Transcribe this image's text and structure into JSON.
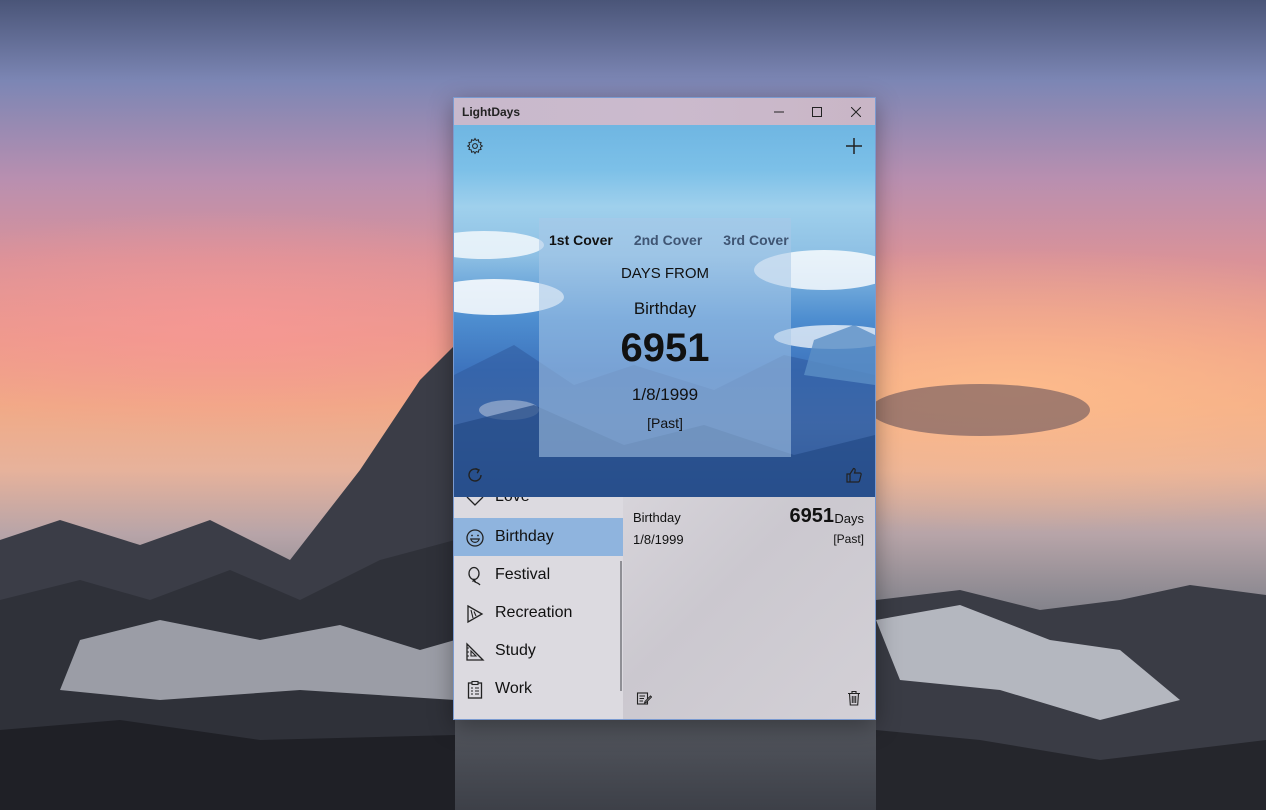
{
  "window": {
    "title": "LightDays"
  },
  "icons": {
    "settings": "gear-icon",
    "add": "plus-icon",
    "refresh": "refresh-icon",
    "like": "thumbs-up-icon",
    "edit": "edit-icon",
    "delete": "trash-icon"
  },
  "cover": {
    "tabs": [
      "1st Cover",
      "2nd Cover",
      "3rd Cover"
    ],
    "active_tab": 0,
    "heading": "DAYS FROM",
    "event_name": "Birthday",
    "count": "6951",
    "date": "1/8/1999",
    "status": "[Past]"
  },
  "categories": [
    {
      "label": "Love",
      "icon": "heart-icon",
      "selected": false
    },
    {
      "label": "Birthday",
      "icon": "smiley-icon",
      "selected": true
    },
    {
      "label": "Festival",
      "icon": "balloon-icon",
      "selected": false
    },
    {
      "label": "Recreation",
      "icon": "party-horn-icon",
      "selected": false
    },
    {
      "label": "Study",
      "icon": "ruler-icon",
      "selected": false
    },
    {
      "label": "Work",
      "icon": "clipboard-icon",
      "selected": false
    }
  ],
  "detail": {
    "name": "Birthday",
    "date": "1/8/1999",
    "count": "6951",
    "unit": "Days",
    "status": "[Past]"
  },
  "colors": {
    "selection": "#8fb4de",
    "window_border": "#7a9ad0",
    "titlebar": "#cbbacd"
  }
}
